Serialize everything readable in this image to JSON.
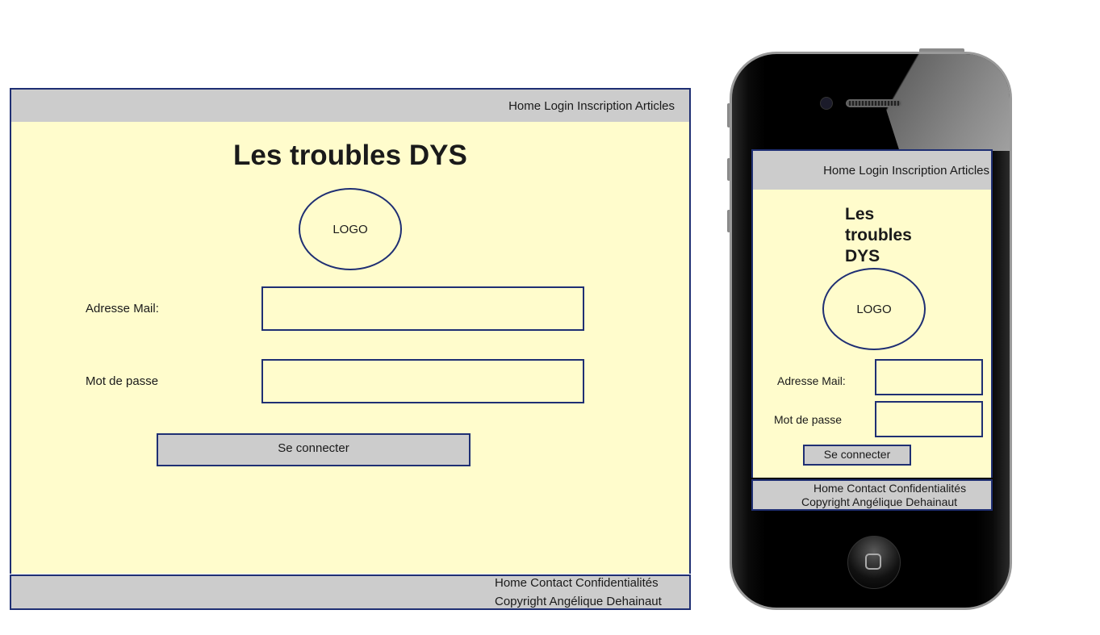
{
  "desktop": {
    "nav": "Home Login Inscription Articles",
    "title": "Les troubles DYS",
    "logo": "LOGO",
    "mail_label": "Adresse Mail:",
    "password_label": "Mot de passe",
    "submit": "Se connecter",
    "footer_links": "Home Contact Confidentialités",
    "copyright": "Copyright Angélique Dehainaut"
  },
  "mobile": {
    "nav": "Home Login Inscription Articles",
    "title": "Les troubles DYS",
    "logo": "LOGO",
    "mail_label": "Adresse Mail:",
    "password_label": "Mot de passe",
    "submit": "Se connecter",
    "footer_links": "Home Contact Confidentialités",
    "copyright": "Copyright Angélique Dehainaut"
  },
  "colors": {
    "border": "#1f2f73",
    "bar": "#cccccc",
    "content_bg": "#fffccc"
  }
}
